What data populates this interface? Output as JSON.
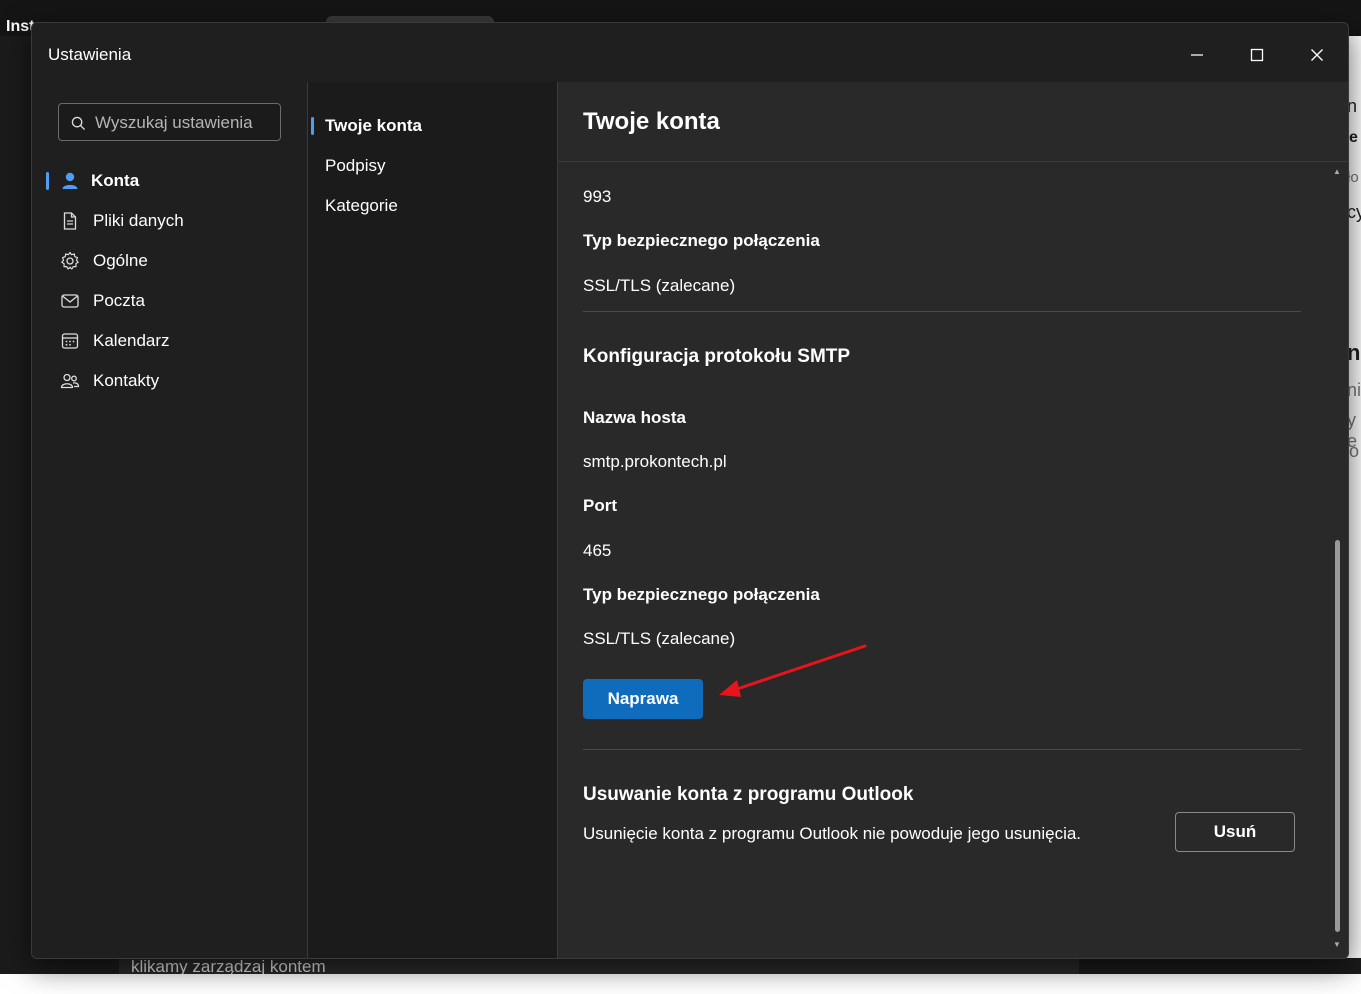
{
  "background": {
    "page_title_fragment": "Inst",
    "bottom_text": "klikamy zarządzaj kontem",
    "right_fragments": [
      "n",
      "e",
      "ło",
      "cy",
      "ne",
      "ni",
      "y e",
      "o"
    ]
  },
  "window": {
    "title": "Ustawienia"
  },
  "search": {
    "placeholder": "Wyszukaj ustawienia"
  },
  "nav_primary": [
    {
      "label": "Konta",
      "icon": "person-icon",
      "active": true
    },
    {
      "label": "Pliki danych",
      "icon": "document-icon",
      "active": false
    },
    {
      "label": "Ogólne",
      "icon": "gear-icon",
      "active": false
    },
    {
      "label": "Poczta",
      "icon": "mail-icon",
      "active": false
    },
    {
      "label": "Kalendarz",
      "icon": "calendar-icon",
      "active": false
    },
    {
      "label": "Kontakty",
      "icon": "people-icon",
      "active": false
    }
  ],
  "nav_secondary": [
    {
      "label": "Twoje konta",
      "active": true
    },
    {
      "label": "Podpisy",
      "active": false
    },
    {
      "label": "Kategorie",
      "active": false
    }
  ],
  "content": {
    "title": "Twoje konta",
    "imap_port_value": "993",
    "imap_security_label": "Typ bezpiecznego połączenia",
    "imap_security_value": "SSL/TLS (zalecane)",
    "smtp_heading": "Konfiguracja protokołu SMTP",
    "smtp_host_label": "Nazwa hosta",
    "smtp_host_value": "smtp.prokontech.pl",
    "smtp_port_label": "Port",
    "smtp_port_value": "465",
    "smtp_security_label": "Typ bezpiecznego połączenia",
    "smtp_security_value": "SSL/TLS (zalecane)",
    "repair_button": "Naprawa",
    "remove_heading": "Usuwanie konta z programu Outlook",
    "remove_description": "Usunięcie konta z programu Outlook nie powoduje jego usunięcia.",
    "remove_button": "Usuń"
  },
  "colors": {
    "accent": "#0f6cbd",
    "active_indicator": "#4f9cf0",
    "annotation_arrow": "#e8141b"
  }
}
